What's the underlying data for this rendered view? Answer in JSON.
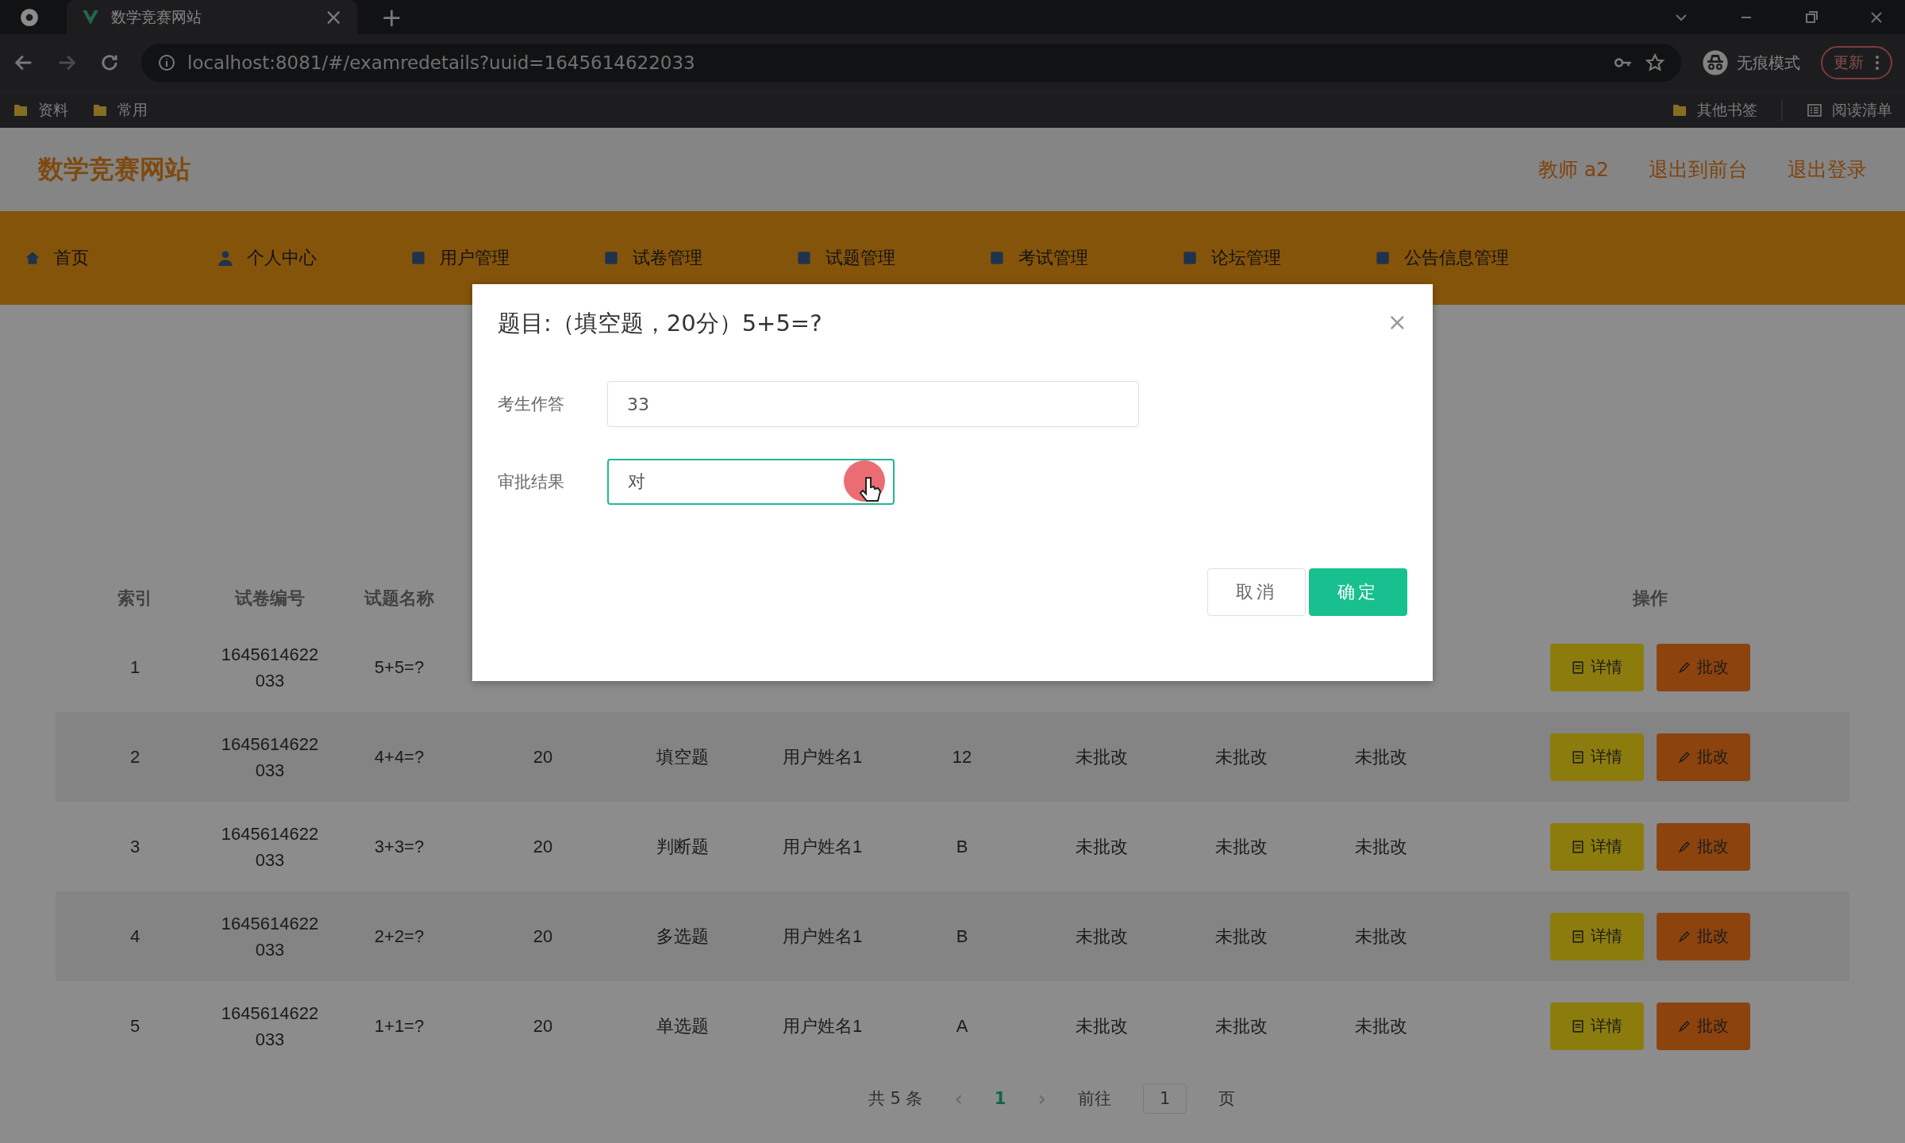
{
  "browser": {
    "tab": {
      "title": "数学竞赛网站",
      "close": "×"
    },
    "new_tab": "+",
    "url": "localhost:8081/#/examredetails?uuid=1645614622033",
    "incognito": "无痕模式",
    "update": "更新",
    "bookmarks": [
      "资料",
      "常用"
    ],
    "bookmarks_right": [
      "其他书签",
      "阅读清单"
    ]
  },
  "header": {
    "site_title": "数学竞赛网站",
    "user": "教师 a2",
    "links": [
      "退出到前台",
      "退出登录"
    ]
  },
  "nav": [
    "首页",
    "个人中心",
    "用户管理",
    "试卷管理",
    "试题管理",
    "考试管理",
    "论坛管理",
    "公告信息管理"
  ],
  "table": {
    "columns": [
      "索引",
      "试卷编号",
      "试题名称",
      "操作"
    ],
    "rows": [
      {
        "index": "1",
        "paper_no": "1645614622033",
        "question": "5+5=?",
        "cells": [],
        "actions": [
          "详情",
          "批改"
        ]
      },
      {
        "index": "2",
        "paper_no": "1645614622033",
        "question": "4+4=?",
        "cells": [
          "20",
          "填空题",
          "用户姓名1",
          "12",
          "未批改",
          "未批改",
          "未批改"
        ],
        "actions": [
          "详情",
          "批改"
        ]
      },
      {
        "index": "3",
        "paper_no": "1645614622033",
        "question": "3+3=?",
        "cells": [
          "20",
          "判断题",
          "用户姓名1",
          "B",
          "未批改",
          "未批改",
          "未批改"
        ],
        "actions": [
          "详情",
          "批改"
        ]
      },
      {
        "index": "4",
        "paper_no": "1645614622033",
        "question": "2+2=?",
        "cells": [
          "20",
          "多选题",
          "用户姓名1",
          "B",
          "未批改",
          "未批改",
          "未批改"
        ],
        "actions": [
          "详情",
          "批改"
        ]
      },
      {
        "index": "5",
        "paper_no": "1645614622033",
        "question": "1+1=?",
        "cells": [
          "20",
          "单选题",
          "用户姓名1",
          "A",
          "未批改",
          "未批改",
          "未批改"
        ],
        "actions": [
          "详情",
          "批改"
        ]
      }
    ]
  },
  "pagination": {
    "total": "共 5 条",
    "prev": "‹",
    "pages": [
      {
        "label": "1",
        "selected": true
      }
    ],
    "next": "›",
    "goto": "前往",
    "page_input": "1",
    "page_unit": "页"
  },
  "dialog": {
    "title": "题目:（填空题，20分）5+5=?",
    "close": "×",
    "fields": [
      {
        "label": "考生作答",
        "value": "33",
        "focused": false
      },
      {
        "label": "审批结果",
        "value": "对",
        "focused": true
      }
    ],
    "buttons": [
      {
        "label": "取消",
        "kind": "default"
      },
      {
        "label": "确定",
        "kind": "primary"
      }
    ]
  }
}
